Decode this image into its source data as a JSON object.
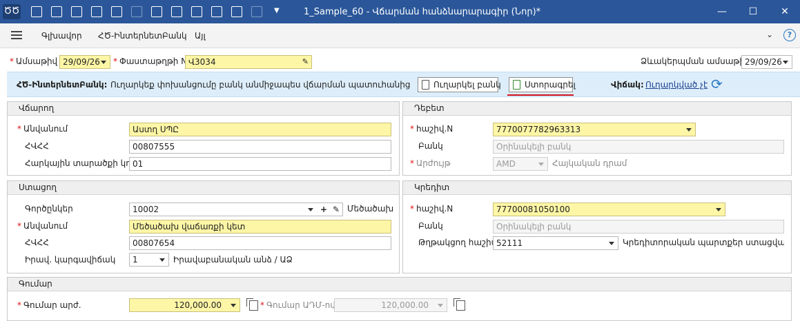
{
  "window": {
    "title": "1_Sample_60 - Վճարման հանձնարարագիր (Նոր)*",
    "logo_glyph": "ԾԾ",
    "controls": {
      "minimize": "—",
      "maximize": "☐",
      "close": "✕"
    }
  },
  "menu": {
    "items": [
      "Գլխավոր",
      "ՀԾ-Ինտերնետ­Բանկ",
      "Այլ"
    ],
    "collapse_glyph": "⌄",
    "help_glyph": "?"
  },
  "header": {
    "date_label": "Ամսաթիվ",
    "date_value": "29/09/26",
    "doc_no_label": "Փաստաթղթի N",
    "doc_no_value": "Վ3034",
    "transfer_date_label": "Ձևակերպման ամսաթիվ",
    "transfer_date_value": "29/09/26"
  },
  "infobar": {
    "title": "ՀԾ-ԻնտերնետԲանկ:",
    "text": "Ուղարկեք փոխանցումը բանկ անմիջապես վճարման պատուհանից",
    "send_button": "Ուղարկել բանկ",
    "sign_button": "Ստորագրել",
    "status_label": "Վիճակ:",
    "status_value": "Ուղարկված չէ"
  },
  "payer": {
    "title": "Վճարող",
    "name_label": "Անվանում",
    "name_value": "Աստղ ՍՊԸ",
    "tin_label": "ՀՎՀՀ",
    "tin_value": "00807555",
    "tax_region_label": "Հարկային տարածքի կոդ",
    "tax_region_value": "01"
  },
  "debit": {
    "title": "Դեբետ",
    "account_label": "հաշիվ.N",
    "account_value": "7770077782963313",
    "bank_label": "Բանկ",
    "bank_placeholder": "Օրինակելի բանկ",
    "currency_label": "Արժույթ",
    "currency_code": "AMD",
    "currency_name": "Հայկական դրամ"
  },
  "recipient": {
    "title": "Ստացող",
    "partners_label": "Գործընկեր",
    "partners_value": "10002",
    "partners_name": "Մեծածախ",
    "name_label": "Անվանում",
    "name_value": "Մեծածախ վաճառքի կետ",
    "tin_label": "ՀՎՀՀ",
    "tin_value": "00807654",
    "legal_status_label": "Իրավ. կարգավիճակ",
    "legal_status_value": "1",
    "legal_status_text": "Իրավաբանական անձ / ԱՁ"
  },
  "credit": {
    "title": "Կրեդիտ",
    "account_label": "հաշիվ.N",
    "account_value": "77700081050100",
    "bank_label": "Բանկ",
    "bank_placeholder": "Օրինակելի բանկ",
    "corr_label": "Թղթակցող հաշիվ",
    "corr_value": "52111",
    "corr_text": "Կրեդիտորական պարտքեր ստացված հո"
  },
  "amount": {
    "title": "Գումար",
    "amount_label": "Գումար արժ.",
    "amount_value": "120,000.00",
    "amd_label": "Գումար ԱԴՄ-ով",
    "amd_value": "120,000.00"
  },
  "colors": {
    "titlebar": "#2b579a",
    "required": "#dd1111",
    "highlight_field": "#fdf6a6",
    "infobar": "#ddeefa",
    "sign_underline": "#d0101a",
    "link": "#1a3f8f"
  }
}
